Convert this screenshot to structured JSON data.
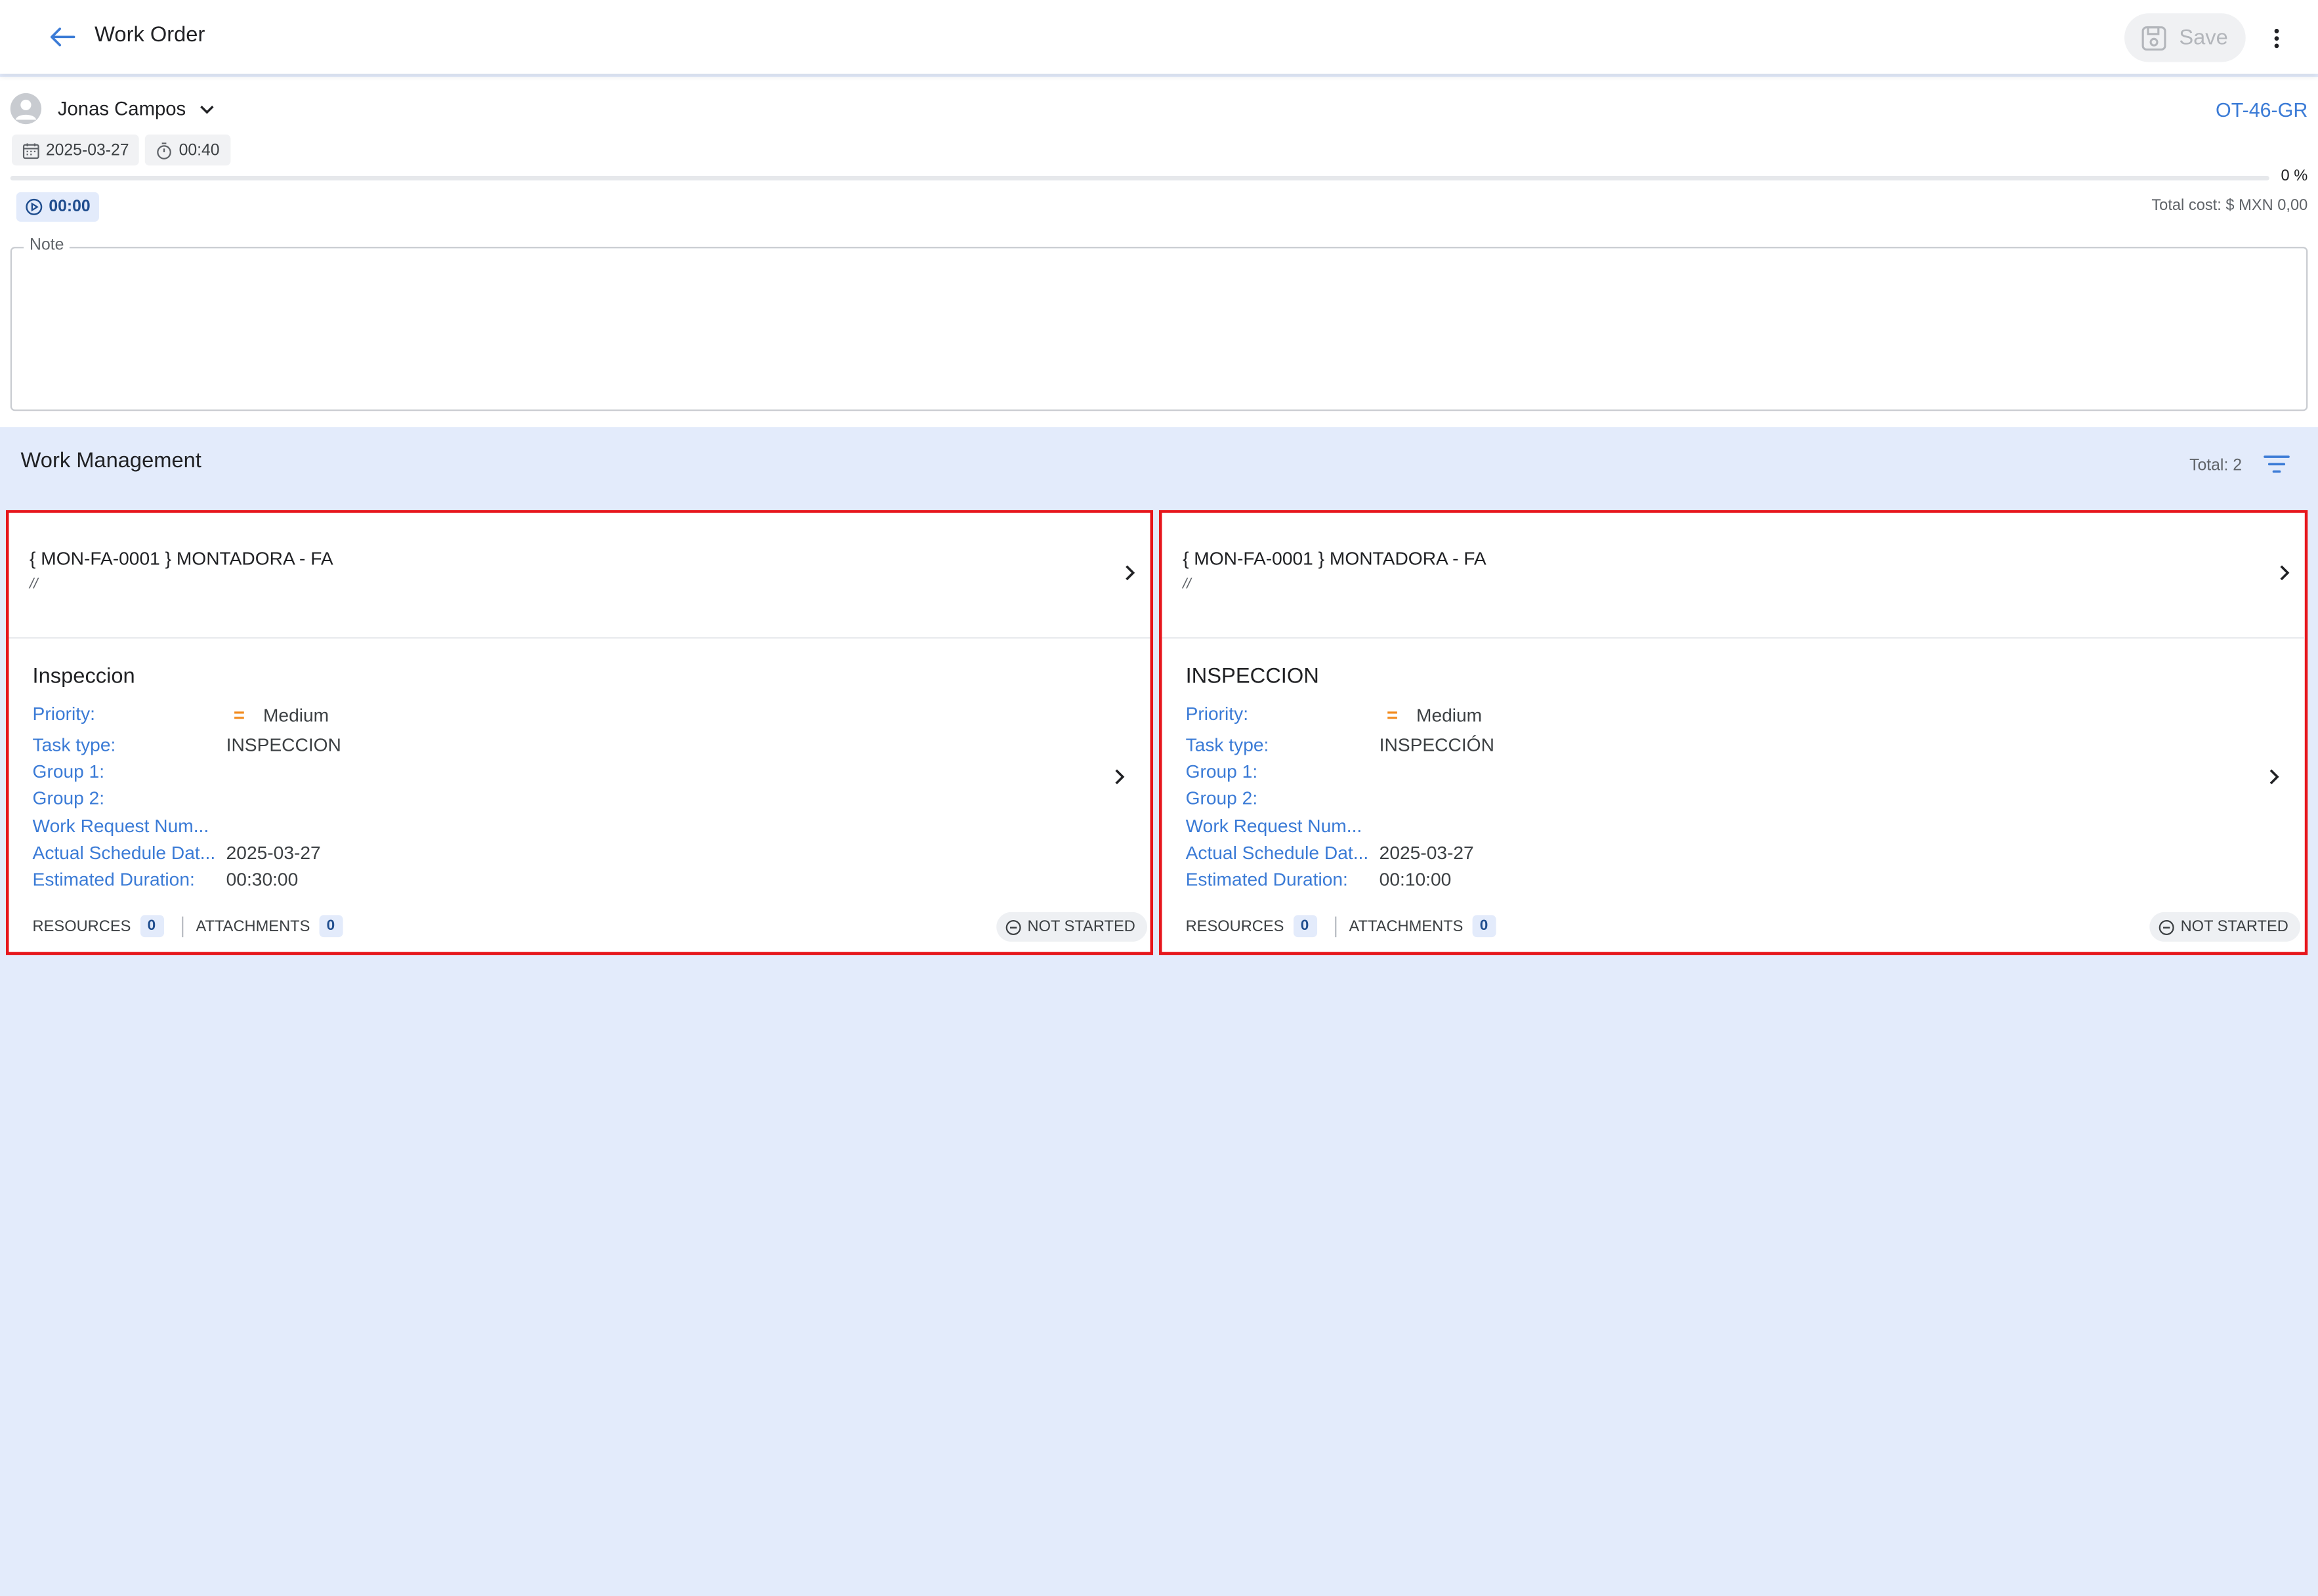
{
  "appbar": {
    "title": "Work Order",
    "save_label": "Save"
  },
  "header": {
    "user_name": "Jonas Campos",
    "work_order_id": "OT-46-GR",
    "date": "2025-03-27",
    "duration": "00:40",
    "progress_percent_label": "0 %",
    "progress_value": 0,
    "timer": "00:00",
    "total_cost": "Total cost: $ MXN 0,00",
    "note_label": "Note",
    "note_value": ""
  },
  "work_management": {
    "title": "Work Management",
    "total_label": "Total: 2",
    "cards": [
      {
        "asset": "{ MON-FA-0001 } MONTADORA - FA",
        "path": "//",
        "task_name": "Inspeccion",
        "fields": {
          "priority_label": "Priority:",
          "priority_value": "Medium",
          "task_type_label": "Task type:",
          "task_type_value": "INSPECCION",
          "group1_label": "Group 1:",
          "group2_label": "Group 2:",
          "work_request_label": "Work Request Num...",
          "actual_schedule_label": "Actual Schedule Dat...",
          "actual_schedule_value": "2025-03-27",
          "estimated_duration_label": "Estimated Duration:",
          "estimated_duration_value": "00:30:00"
        },
        "resources_label": "RESOURCES",
        "resources_count": "0",
        "attachments_label": "ATTACHMENTS",
        "attachments_count": "0",
        "status": "NOT STARTED"
      },
      {
        "asset": "{ MON-FA-0001 } MONTADORA - FA",
        "path": "//",
        "task_name": "INSPECCION",
        "fields": {
          "priority_label": "Priority:",
          "priority_value": "Medium",
          "task_type_label": "Task type:",
          "task_type_value": "INSPECCIÓN",
          "group1_label": "Group 1:",
          "group2_label": "Group 2:",
          "work_request_label": "Work Request Num...",
          "actual_schedule_label": "Actual Schedule Dat...",
          "actual_schedule_value": "2025-03-27",
          "estimated_duration_label": "Estimated Duration:",
          "estimated_duration_value": "00:10:00"
        },
        "resources_label": "RESOURCES",
        "resources_count": "0",
        "attachments_label": "ATTACHMENTS",
        "attachments_count": "0",
        "status": "NOT STARTED"
      }
    ]
  },
  "colors": {
    "accent": "#3b7bd6",
    "background": "#e3ebfb",
    "highlight_border": "#e6161c",
    "priority_medium": "#f28b1e"
  },
  "icons": [
    "arrow-left-icon",
    "save-icon",
    "more-vert-icon",
    "avatar-icon",
    "chevron-down-icon",
    "calendar-icon",
    "stopwatch-icon",
    "play-circle-icon",
    "filter-icon",
    "chevron-right-icon",
    "minus-circle-icon",
    "priority-equals-icon"
  ]
}
